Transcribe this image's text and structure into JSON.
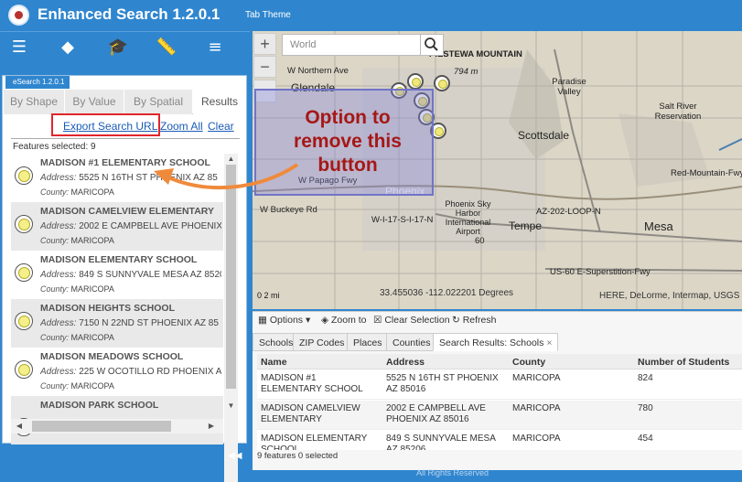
{
  "header": {
    "title": "Enhanced Search 1.2.0.1",
    "theme": "Tab Theme"
  },
  "toolbar": {
    "icons": [
      "list-icon",
      "layers-icon",
      "graduation-cap-icon",
      "ruler-icon",
      "menu-icon"
    ]
  },
  "panel": {
    "badge": "eSearch 1.2.0.1",
    "tabs": [
      "By Shape",
      "By Value",
      "By Spatial",
      "Results"
    ],
    "active_tab": "Results",
    "links": {
      "export": "Export Search URL",
      "zoom_all": "Zoom All",
      "clear": "Clear"
    },
    "features_selected": "Features selected: 9",
    "address_label": "Address:",
    "county_label": "County:",
    "results": [
      {
        "name": "MADISON #1 ELEMENTARY SCHOOL",
        "address": "5525 N 16TH ST PHOENIX AZ 85",
        "county": "MARICOPA"
      },
      {
        "name": "MADISON CAMELVIEW ELEMENTARY",
        "address": "2002 E CAMPBELL AVE PHOENIX A",
        "county": "MARICOPA"
      },
      {
        "name": "MADISON ELEMENTARY SCHOOL",
        "address": "849 S SUNNYVALE MESA AZ 8520",
        "county": "MARICOPA"
      },
      {
        "name": "MADISON HEIGHTS SCHOOL",
        "address": "7150 N 22ND ST PHOENIX AZ 85",
        "county": "MARICOPA"
      },
      {
        "name": "MADISON MEADOWS SCHOOL",
        "address": "225 W OCOTILLO RD PHOENIX AZ",
        "county": "MARICOPA"
      },
      {
        "name": "MADISON PARK SCHOOL",
        "address": "",
        "county": ""
      }
    ]
  },
  "map": {
    "search_placeholder": "World",
    "labels": {
      "glendale": "Glendale",
      "northern_ave": "W Northern Ave",
      "piestewa": "PIESTEWA MOUNTAIN",
      "elev": "794 m",
      "paradise": "Paradise Valley",
      "salt_river": "Salt River Reservation",
      "scottsdale": "Scottsdale",
      "phoenix": "Phoenix",
      "airport": "Phoenix Sky Harbor International Airport",
      "tempe": "Tempe",
      "mesa": "Mesa",
      "buckeye": "W Buckeye Rd",
      "i17": "W-I-17-S-I-17-N",
      "us60": "US-60 E-Superstition-Fwy",
      "redmountain": "Red-Mountain-Fwy",
      "papago": "W Papago Fwy",
      "loop202": "AZ-202-LOOP-N",
      "num60": "60"
    },
    "coords": "33.455036 -112.022201 Degrees",
    "attribution": "HERE, DeLorme, Intermap, USGS",
    "scale": "0   2 mi"
  },
  "callout": {
    "line1": "Option to",
    "line2": "remove this",
    "line3": "button"
  },
  "bottom": {
    "toolbar": {
      "options": "Options",
      "zoom": "Zoom to",
      "clear": "Clear Selection",
      "refresh": "Refresh"
    },
    "tabs": [
      "Schools",
      "ZIP Codes",
      "Places",
      "Counties",
      "Search Results: Schools"
    ],
    "columns": [
      "Name",
      "Address",
      "County",
      "Number of Students"
    ],
    "rows": [
      {
        "name": "MADISON #1 ELEMENTARY SCHOOL",
        "address": "5525 N 16TH ST PHOENIX AZ 85016",
        "county": "MARICOPA",
        "students": "824"
      },
      {
        "name": "MADISON CAMELVIEW ELEMENTARY",
        "address": "2002 E CAMPBELL AVE PHOENIX AZ 85016",
        "county": "MARICOPA",
        "students": "780"
      },
      {
        "name": "MADISON ELEMENTARY SCHOOL",
        "address": "849 S SUNNYVALE MESA AZ 85206",
        "county": "MARICOPA",
        "students": "454"
      }
    ],
    "status": "9 features 0 selected"
  },
  "footer": "All Rights Reserved"
}
